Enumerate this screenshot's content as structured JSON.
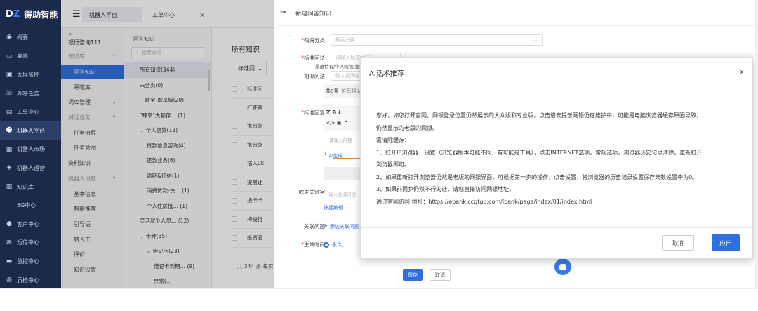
{
  "brand": {
    "logo_prefix": "D",
    "logo_accent": "Z",
    "name": "得助智能"
  },
  "topbar": {
    "tabs": [
      "机器人平台",
      "工单中心"
    ],
    "close": "×"
  },
  "nav": [
    {
      "label": "概要",
      "icon": "dashboard-icon"
    },
    {
      "label": "桌面",
      "icon": "desktop-icon"
    },
    {
      "label": "大屏监控",
      "icon": "monitor-icon"
    },
    {
      "label": "外呼任务",
      "icon": "phone-icon"
    },
    {
      "label": "工单中心",
      "icon": "ticket-icon"
    },
    {
      "label": "机器人平台",
      "icon": "robot-icon",
      "active": true
    },
    {
      "label": "机器人市场",
      "icon": "market-icon"
    },
    {
      "label": "机器人运营",
      "icon": "operations-icon"
    },
    {
      "label": "知识库",
      "icon": "knowledge-icon"
    },
    {
      "label": "5G中心",
      "icon": "5g-icon"
    },
    {
      "label": "客户中心",
      "icon": "customer-icon"
    },
    {
      "label": "短信中心",
      "icon": "sms-icon"
    },
    {
      "label": "监控中心",
      "icon": "screen-icon"
    },
    {
      "label": "质检中心",
      "icon": "quality-icon"
    }
  ],
  "submenu": {
    "collapse": "«",
    "org": "银行咨询111",
    "items": [
      {
        "label": "知识库",
        "type": "group",
        "arrow": "^"
      },
      {
        "label": "问答知识",
        "type": "child",
        "active": true
      },
      {
        "label": "寒暄库",
        "type": "child"
      },
      {
        "label": "词库管理",
        "type": "item",
        "arrow": "⌄"
      },
      {
        "label": "对话任务",
        "type": "group",
        "arrow": "^"
      },
      {
        "label": "任务流程",
        "type": "child"
      },
      {
        "label": "任务意图",
        "type": "child"
      },
      {
        "label": "资料知识",
        "type": "item",
        "arrow": "⌄"
      },
      {
        "label": "机器人设置",
        "type": "group",
        "arrow": "^"
      },
      {
        "label": "基本信息",
        "type": "child"
      },
      {
        "label": "智能推荐",
        "type": "child"
      },
      {
        "label": "引导语",
        "type": "child"
      },
      {
        "label": "转人工",
        "type": "child"
      },
      {
        "label": "评价",
        "type": "child"
      },
      {
        "label": "知识设置",
        "type": "child"
      }
    ]
  },
  "tree": {
    "title": "问答知识",
    "search_placeholder": "搜索分类",
    "items": [
      {
        "label": "所有知识(344)",
        "indent": 0,
        "selected": true
      },
      {
        "label": "未分类(0)",
        "indent": 0
      },
      {
        "label": "三峡宝-即享版(20)",
        "indent": 0
      },
      {
        "label": "\"臻享\"大额存… (1)",
        "indent": 0
      },
      {
        "label": "⌄ 个人信贷(13)",
        "indent": 0
      },
      {
        "label": "贷款信息咨询(4)",
        "indent": 1
      },
      {
        "label": "还款业务(6)",
        "indent": 1
      },
      {
        "label": "逾期&征信(1)",
        "indent": 1
      },
      {
        "label": "消费贷款-快… (1)",
        "indent": 1
      },
      {
        "label": "个人住房抵… (1)",
        "indent": 1
      },
      {
        "label": "灵活就业人员… (12)",
        "indent": 0
      },
      {
        "label": "⌄ 卡种(35)",
        "indent": 0
      },
      {
        "label": "⌄ 借记卡(23)",
        "indent": 1
      },
      {
        "label": "借记卡到期… (9)",
        "indent": 2
      },
      {
        "label": "异常(1)",
        "indent": 2
      }
    ]
  },
  "main": {
    "title": "所有知识",
    "filter": "标准问",
    "rows": [
      "标准问",
      "打开官",
      "携带外",
      "携带外",
      "插入uk",
      "提前还",
      "换卡卡",
      "持投行",
      "投资者"
    ],
    "footer": "共 344 条 每页"
  },
  "drawer": {
    "back": "→",
    "title": "新建问答知识",
    "fields": {
      "category_label": "归属分类",
      "category_placeholder": "搜索分类",
      "std_q_label": "标准问法",
      "std_q_placeholder": "请输入标准问法",
      "std_q_note": "渠道特有/个人网银/业务",
      "similar_label": "相似问法",
      "similar_placeholder": "输入类同名称",
      "similar_count": "共0条",
      "similar_recommend": "推荐相似",
      "answer_label": "标准回复",
      "answer_placeholder": "请输入内容",
      "ai_generate": "AI生成",
      "trigger_label": "触发关键字",
      "trigger_placeholder": "输入关键词搜",
      "quick_edit": "快捷编辑",
      "related_label": "关联问题",
      "related_add": "添加关联问题",
      "effective_label": "生效时间",
      "effective_value": "永久",
      "save": "保存",
      "cancel": "取消"
    },
    "toolbar": [
      "T̸",
      "B",
      "I",
      "</>",
      "▣",
      "♬"
    ]
  },
  "modal": {
    "title": "AI话术推荐",
    "close": "X",
    "paragraphs": [
      "您好，如您打开官网，网银登录位置仍然展示的大众版和专业版，点击进去提示网银仍在维护中，可能是电脑浏览器缓存原因导致，",
      "仍然显示的老版的网银。",
      "需清除缓存：",
      "1、打开IE浏览器，设置（浏览器版本可能不同，有可能是工具），点击INTERNET选项，常规选项，浏览器历史记录清除。重新打开",
      "浏览器即可。",
      "2、如果重新打开浏览器仍然是老版的网银界面，可根据第一步的操作，点击设置，将浏览器的历史记录设置保存天数设置中为0。",
      "3、如果前两步仍然不行的话，请您直接访问网银地址，",
      "通过官网访问 地址：https://ebank.ccqtgb.com/ibank/page/index/01/index.html"
    ],
    "cancel": "取消",
    "apply": "应用"
  },
  "colors": {
    "sidebar": "#1b2a4a",
    "accent": "#2f6fe0"
  }
}
